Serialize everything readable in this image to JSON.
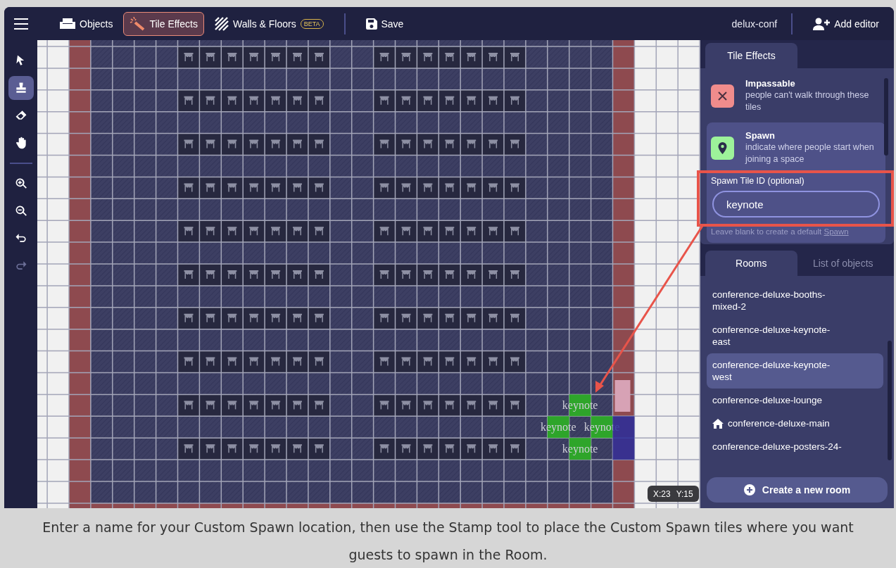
{
  "top_bar": {
    "tabs": [
      {
        "kind": "objects",
        "label": "Objects",
        "selected": false
      },
      {
        "kind": "tile-effects",
        "label": "Tile Effects",
        "selected": true
      },
      {
        "kind": "walls",
        "label": "Walls & Floors",
        "badge": "BETA",
        "selected": false
      }
    ],
    "save": "Save",
    "space_name": "delux-conf",
    "add_editor": "Add editor"
  },
  "tool_groups": [
    [
      {
        "kind": "select",
        "selected": false,
        "disabled": false
      },
      {
        "kind": "stamp",
        "selected": true,
        "disabled": false
      },
      {
        "kind": "eraser",
        "selected": false,
        "disabled": false
      },
      {
        "kind": "hand",
        "selected": false,
        "disabled": false
      }
    ],
    [
      {
        "kind": "zoom-in",
        "selected": false,
        "disabled": false
      },
      {
        "kind": "zoom-out",
        "selected": false,
        "disabled": false
      },
      {
        "kind": "undo",
        "selected": false,
        "disabled": false
      },
      {
        "kind": "redo",
        "selected": false,
        "disabled": true
      }
    ]
  ],
  "canvas": {
    "spawn_tiles": [
      {
        "label": "keynote"
      },
      {
        "label": "keynote"
      },
      {
        "label": "keynote"
      },
      {
        "label": "keynote"
      }
    ],
    "coordinates": {
      "x": "X:23",
      "y": "Y:15"
    }
  },
  "tile_effects": {
    "tab": "Tile Effects",
    "effects": [
      {
        "kind": "impassable",
        "title": "Impassable",
        "description": "people can't walk through these tiles",
        "selected": false
      },
      {
        "kind": "spawn",
        "title": "Spawn",
        "description": "indicate where people start when joining a space",
        "selected": true
      }
    ],
    "spawn_field": {
      "label": "Spawn Tile ID (optional)",
      "value": "keynote",
      "help": "Leave blank to create a default",
      "help_link": "Spawn"
    }
  },
  "rooms": {
    "tabs": [
      {
        "label": "Rooms",
        "selected": true
      },
      {
        "label": "List of objects",
        "selected": false
      }
    ],
    "items": [
      {
        "name": "conference-deluxe-booths-mixed-2",
        "selected": false,
        "home": false
      },
      {
        "name": "conference-deluxe-keynote-east",
        "selected": false,
        "home": false
      },
      {
        "name": "conference-deluxe-keynote-west",
        "selected": true,
        "home": false
      },
      {
        "name": "conference-deluxe-lounge",
        "selected": false,
        "home": false
      },
      {
        "name": "conference-deluxe-main",
        "selected": false,
        "home": true
      },
      {
        "name": "conference-deluxe-posters-24-",
        "selected": false,
        "home": false
      }
    ],
    "create_button": "Create a new room"
  },
  "caption": "Enter a name for your Custom Spawn location, then use the Stamp tool to place the Custom Spawn tiles where you want guests to spawn in the Room."
}
